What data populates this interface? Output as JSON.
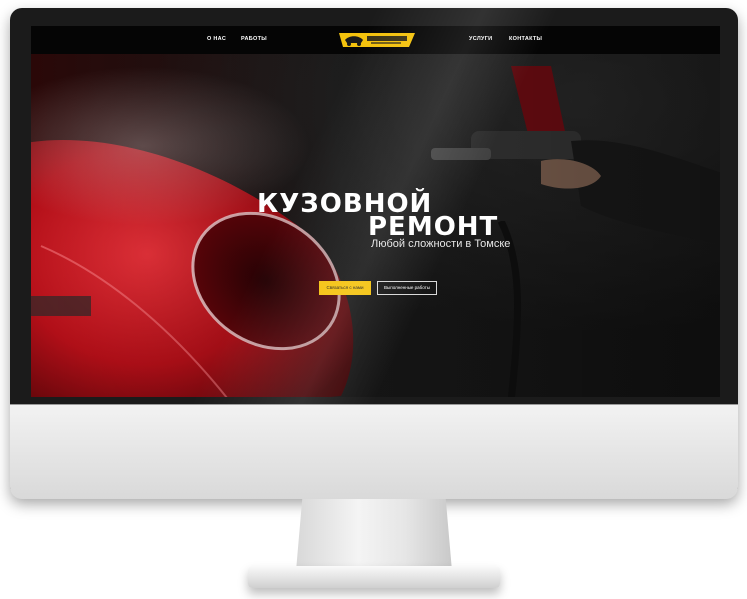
{
  "colors": {
    "accent": "#f4c20d",
    "bumper_red": "#c4101b",
    "nav_bg": "#050505",
    "text": "#ffffff"
  },
  "nav": {
    "left_items": [
      "О НАС",
      "РАБОТЫ"
    ],
    "right_items": [
      "УСЛУГИ",
      "КОНТАКТЫ"
    ]
  },
  "logo": {
    "icon": "car-logo-icon"
  },
  "hero": {
    "title_line1": "КУЗОВНОЙ",
    "title_line2": "РЕМОНТ",
    "subtitle": "Любой сложности в Томске",
    "primary_button": "Связаться с нами",
    "secondary_button": "Выполненные работы"
  }
}
